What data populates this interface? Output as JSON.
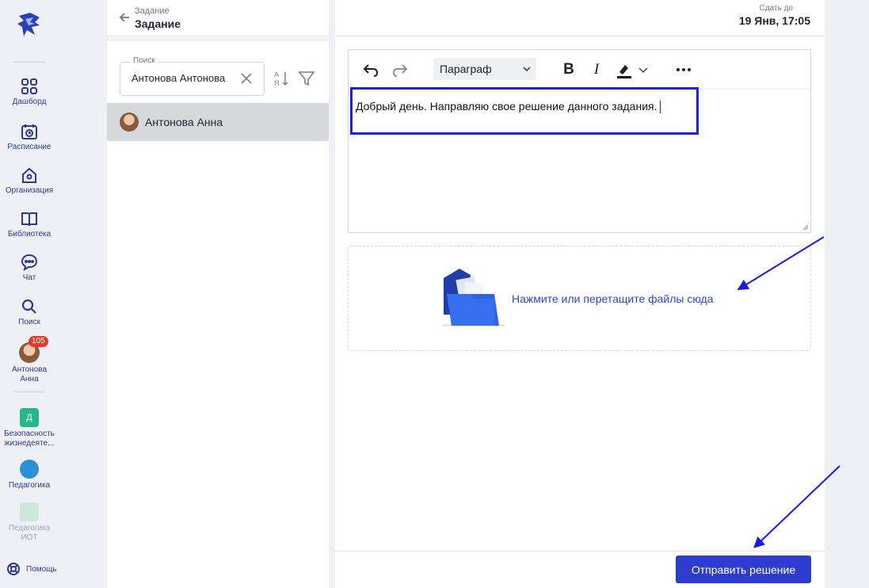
{
  "nav": {
    "items": [
      {
        "label": "Дашборд",
        "icon": "dashboard-icon"
      },
      {
        "label": "Расписание",
        "icon": "calendar-icon"
      },
      {
        "label": "Организация",
        "icon": "organization-icon"
      },
      {
        "label": "Библиотека",
        "icon": "book-icon"
      },
      {
        "label": "Чат",
        "icon": "chat-icon"
      },
      {
        "label": "Поиск",
        "icon": "search-icon"
      }
    ],
    "profile": {
      "name_line1": "Антонова",
      "name_line2": "Анна",
      "badge": "105"
    },
    "courses": [
      {
        "label_line1": "Безопасность",
        "label_line2": "жизнедеяте...",
        "icon_letter": "Д"
      },
      {
        "label_line1": "Педагогика",
        "label_line2": ""
      },
      {
        "label_line1": "Педагогика",
        "label_line2": "ИОТ"
      }
    ],
    "help_label": "Помощь"
  },
  "breadcrumb": {
    "parent": "Задание",
    "title": "Задание"
  },
  "search": {
    "label": "Поиск",
    "value": "Антонова Антонова"
  },
  "students": [
    {
      "name": "Антонова Анна"
    }
  ],
  "due": {
    "label": "Сдать до",
    "date": "19 Янв, 17:05"
  },
  "editor": {
    "format": "Параграф",
    "bold_label": "B",
    "italic_label": "I",
    "text": "Добрый день. Направляю свое решение данного задания."
  },
  "dropzone": {
    "text": "Нажмите или перетащите файлы сюда"
  },
  "footer": {
    "submit_label": "Отправить решение"
  },
  "colors": {
    "accent": "#2d3ccf",
    "highlight_border": "#1a21e0",
    "badge": "#e23a2c"
  }
}
